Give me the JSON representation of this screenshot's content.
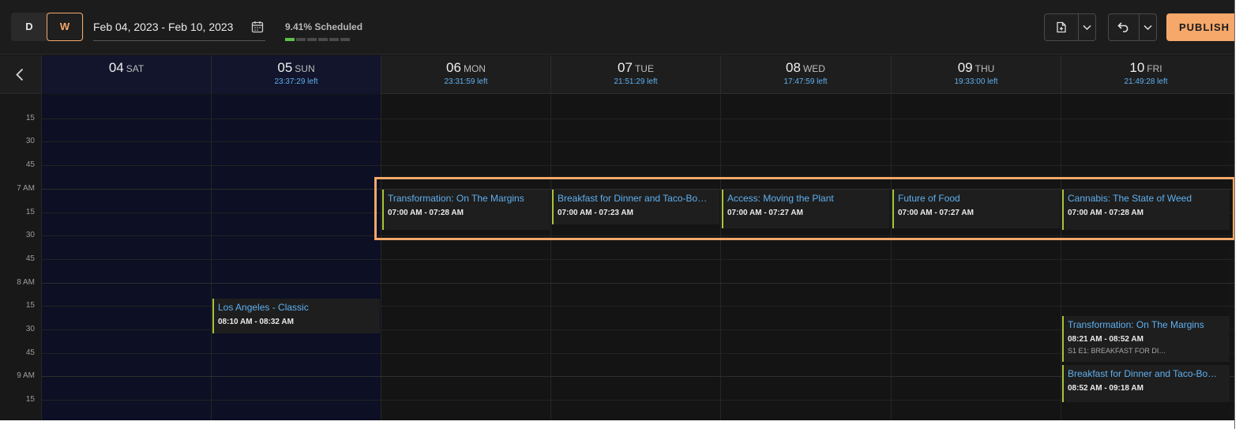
{
  "toolbar": {
    "view_day": "D",
    "view_week": "W",
    "date_range": "Feb 04, 2023 - Feb 10, 2023",
    "scheduled_label": "9.41% Scheduled",
    "scheduled_percent": 9.41,
    "publish_label": "PUBLISH"
  },
  "icons": {
    "calendar": "calendar-icon",
    "export": "file-export-icon",
    "undo": "undo-icon",
    "chevron": "chevron-down-icon",
    "prev": "chevron-left-icon"
  },
  "colors": {
    "accent": "#f5a86a",
    "link": "#5fb0f0",
    "event_bar": "#a8c63a",
    "weekend_bg": "#0d0f24"
  },
  "days": [
    {
      "num": "04",
      "dow": "SAT",
      "left": ""
    },
    {
      "num": "05",
      "dow": "SUN",
      "left": "23:37:29 left"
    },
    {
      "num": "06",
      "dow": "MON",
      "left": "23:31:59 left"
    },
    {
      "num": "07",
      "dow": "TUE",
      "left": "21:51:29 left"
    },
    {
      "num": "08",
      "dow": "WED",
      "left": "17:47:59 left"
    },
    {
      "num": "09",
      "dow": "THU",
      "left": "19:33:00 left"
    },
    {
      "num": "10",
      "dow": "FRI",
      "left": "21:49:28 left"
    }
  ],
  "time_labels": [
    "15",
    "30",
    "45",
    "7 AM",
    "15",
    "30",
    "45",
    "8 AM",
    "15",
    "30",
    "45",
    "9 AM",
    "15"
  ],
  "events": [
    {
      "day": 2,
      "title": "Transformation: On The Margins",
      "time": "07:00 AM - 07:28 AM",
      "sub": ""
    },
    {
      "day": 3,
      "title": "Breakfast for Dinner and Taco-Bo…",
      "time": "07:00 AM - 07:23 AM",
      "sub": ""
    },
    {
      "day": 4,
      "title": "Access: Moving the Plant",
      "time": "07:00 AM - 07:27 AM",
      "sub": ""
    },
    {
      "day": 5,
      "title": "Future of Food",
      "time": "07:00 AM - 07:27 AM",
      "sub": ""
    },
    {
      "day": 6,
      "title": "Cannabis: The State of Weed",
      "time": "07:00 AM - 07:28 AM",
      "sub": ""
    },
    {
      "day": 1,
      "title": "Los Angeles - Classic",
      "time": "08:10 AM - 08:32 AM",
      "sub": ""
    },
    {
      "day": 6,
      "title": "Transformation: On The Margins",
      "time": "08:21 AM - 08:52 AM",
      "sub": "S1 E1: BREAKFAST FOR DI…"
    },
    {
      "day": 6,
      "title": "Breakfast for Dinner and Taco-Bo…",
      "time": "08:52 AM - 09:18 AM",
      "sub": ""
    }
  ]
}
